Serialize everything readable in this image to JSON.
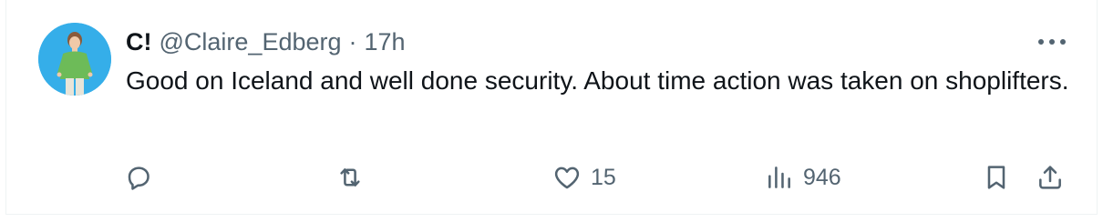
{
  "tweet": {
    "display_name": "C!",
    "handle": "@Claire_Edberg",
    "separator": "·",
    "time": "17h",
    "text": "Good on Iceland and well done security. About time action was taken on shoplifters."
  },
  "avatar": {
    "icon": "person-avatar",
    "background_color": "#35aee9"
  },
  "actions": {
    "reply_icon": "speech-bubble-icon",
    "retweet_icon": "retweet-icon",
    "like_icon": "heart-icon",
    "like_count": "15",
    "views_icon": "bar-chart-icon",
    "views_count": "946",
    "bookmark_icon": "bookmark-icon",
    "share_icon": "share-icon"
  },
  "colors": {
    "text_primary": "#0f1419",
    "text_secondary": "#536471",
    "border": "#eff3f4"
  }
}
